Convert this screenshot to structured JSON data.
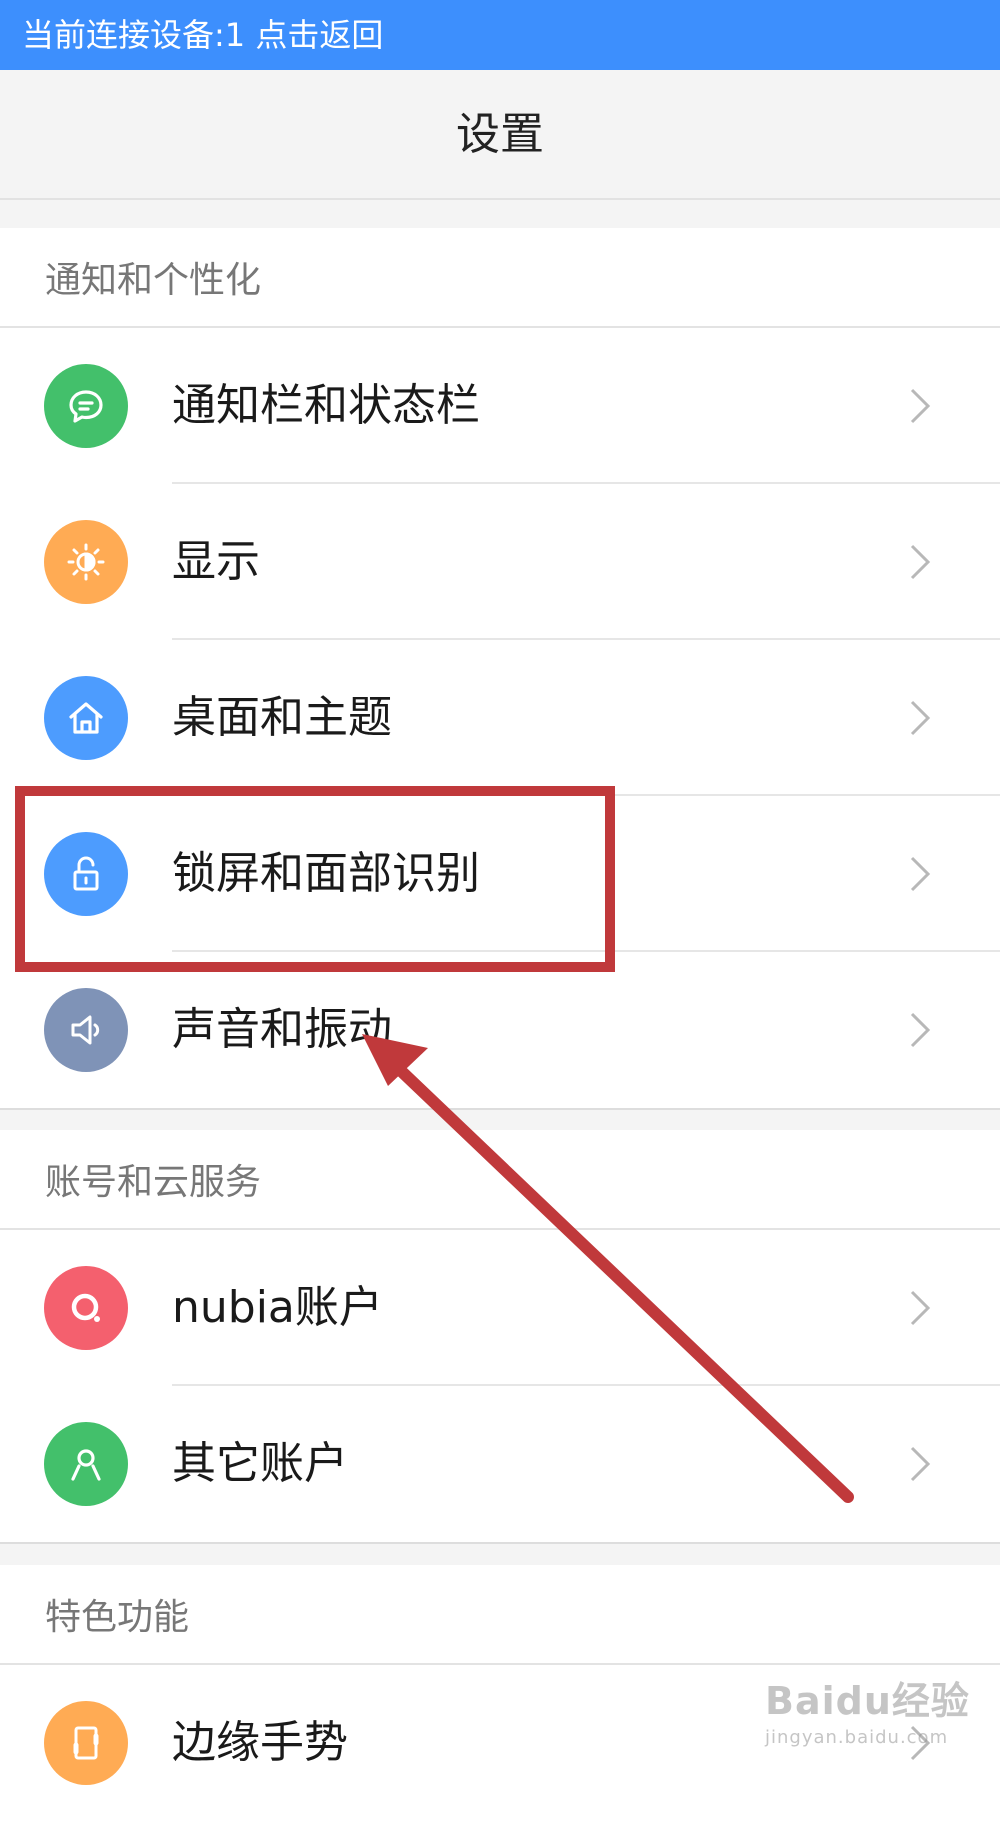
{
  "status_bar": {
    "text": "当前连接设备:1  点击返回"
  },
  "header": {
    "title": "设置"
  },
  "sections": [
    {
      "title": "通知和个性化",
      "items": [
        {
          "label": "通知栏和状态栏",
          "icon": "chat-bubble-icon",
          "color": "#43c06b"
        },
        {
          "label": "显示",
          "icon": "brightness-icon",
          "color": "#ffab54"
        },
        {
          "label": "桌面和主题",
          "icon": "home-icon",
          "color": "#4d9cfe"
        },
        {
          "label": "锁屏和面部识别",
          "icon": "unlock-icon",
          "color": "#4d9cfe"
        },
        {
          "label": "声音和振动",
          "icon": "speaker-icon",
          "color": "#7f93b7"
        }
      ]
    },
    {
      "title": "账号和云服务",
      "items": [
        {
          "label": "nubia账户",
          "icon": "nubia-logo-icon",
          "color": "#f4606e"
        },
        {
          "label": "其它账户",
          "icon": "person-icon",
          "color": "#43c06b"
        }
      ]
    },
    {
      "title": "特色功能",
      "items": [
        {
          "label": "边缘手势",
          "icon": "edge-gesture-icon",
          "color": "#ffab54"
        }
      ]
    }
  ],
  "annotation": {
    "color": "#c0393b"
  },
  "watermark": {
    "logo": "Baidu经验",
    "url": "jingyan.baidu.com"
  }
}
